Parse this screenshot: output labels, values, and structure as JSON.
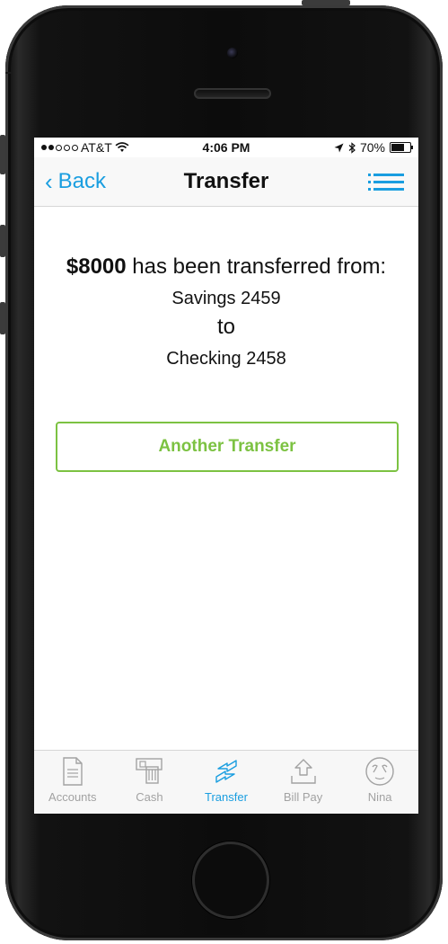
{
  "status_bar": {
    "carrier": "AT&T",
    "time": "4:06 PM",
    "battery": "70%",
    "battery_level": 0.7,
    "signal_bars_filled": 2,
    "signal_bars_total": 5
  },
  "nav": {
    "back_label": "Back",
    "title": "Transfer"
  },
  "message": {
    "amount": "$8000",
    "line1_rest": " has been transferred from:",
    "from_account": "Savings 2459",
    "to_word": "to",
    "to_account": "Checking 2458"
  },
  "actions": {
    "another_transfer_label": "Another Transfer"
  },
  "tabs": [
    {
      "label": "Accounts",
      "icon": "document-icon",
      "active": false
    },
    {
      "label": "Cash",
      "icon": "cash-icon",
      "active": false
    },
    {
      "label": "Transfer",
      "icon": "transfer-arrows-icon",
      "active": true
    },
    {
      "label": "Bill Pay",
      "icon": "upload-tray-icon",
      "active": false
    },
    {
      "label": "Nina",
      "icon": "nina-face-icon",
      "active": false
    }
  ],
  "colors": {
    "accent_blue": "#1a9ee0",
    "accent_green": "#7cc242",
    "tab_inactive": "#a2a2a2"
  }
}
